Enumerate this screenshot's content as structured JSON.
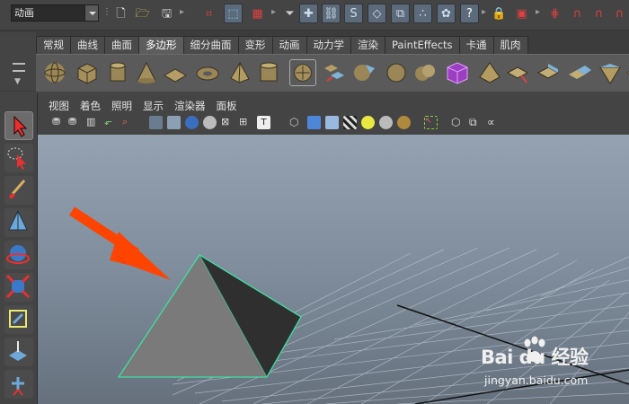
{
  "status_line": {
    "mode": "动画"
  },
  "shelf": {
    "tabs": [
      "常规",
      "曲线",
      "曲面",
      "多边形",
      "细分曲面",
      "变形",
      "动画",
      "动力学",
      "渲染",
      "PaintEffects",
      "卡通",
      "肌肉"
    ],
    "active_tab": "多边形"
  },
  "panel": {
    "menu": [
      "视图",
      "着色",
      "照明",
      "显示",
      "渲染器",
      "面板"
    ]
  },
  "toolbox": {
    "tools": [
      "select-tool",
      "lasso-tool",
      "paint-select-tool",
      "move-tool",
      "rotate-tool",
      "scale-tool",
      "manipulator-tool",
      "last-tool",
      "more-tool"
    ]
  },
  "viewport": {
    "object": "polygon-pyramid",
    "annotation": "red-arrow",
    "colors": {
      "pyramid_light_face": "#7a7a7a",
      "pyramid_dark_face": "#2f2f2f",
      "selection_outline": "#3fe0a0",
      "arrow": "#ff4400"
    }
  },
  "watermark": {
    "logo_text": "Bai du 经验",
    "url": "jingyan.baidu.com"
  }
}
